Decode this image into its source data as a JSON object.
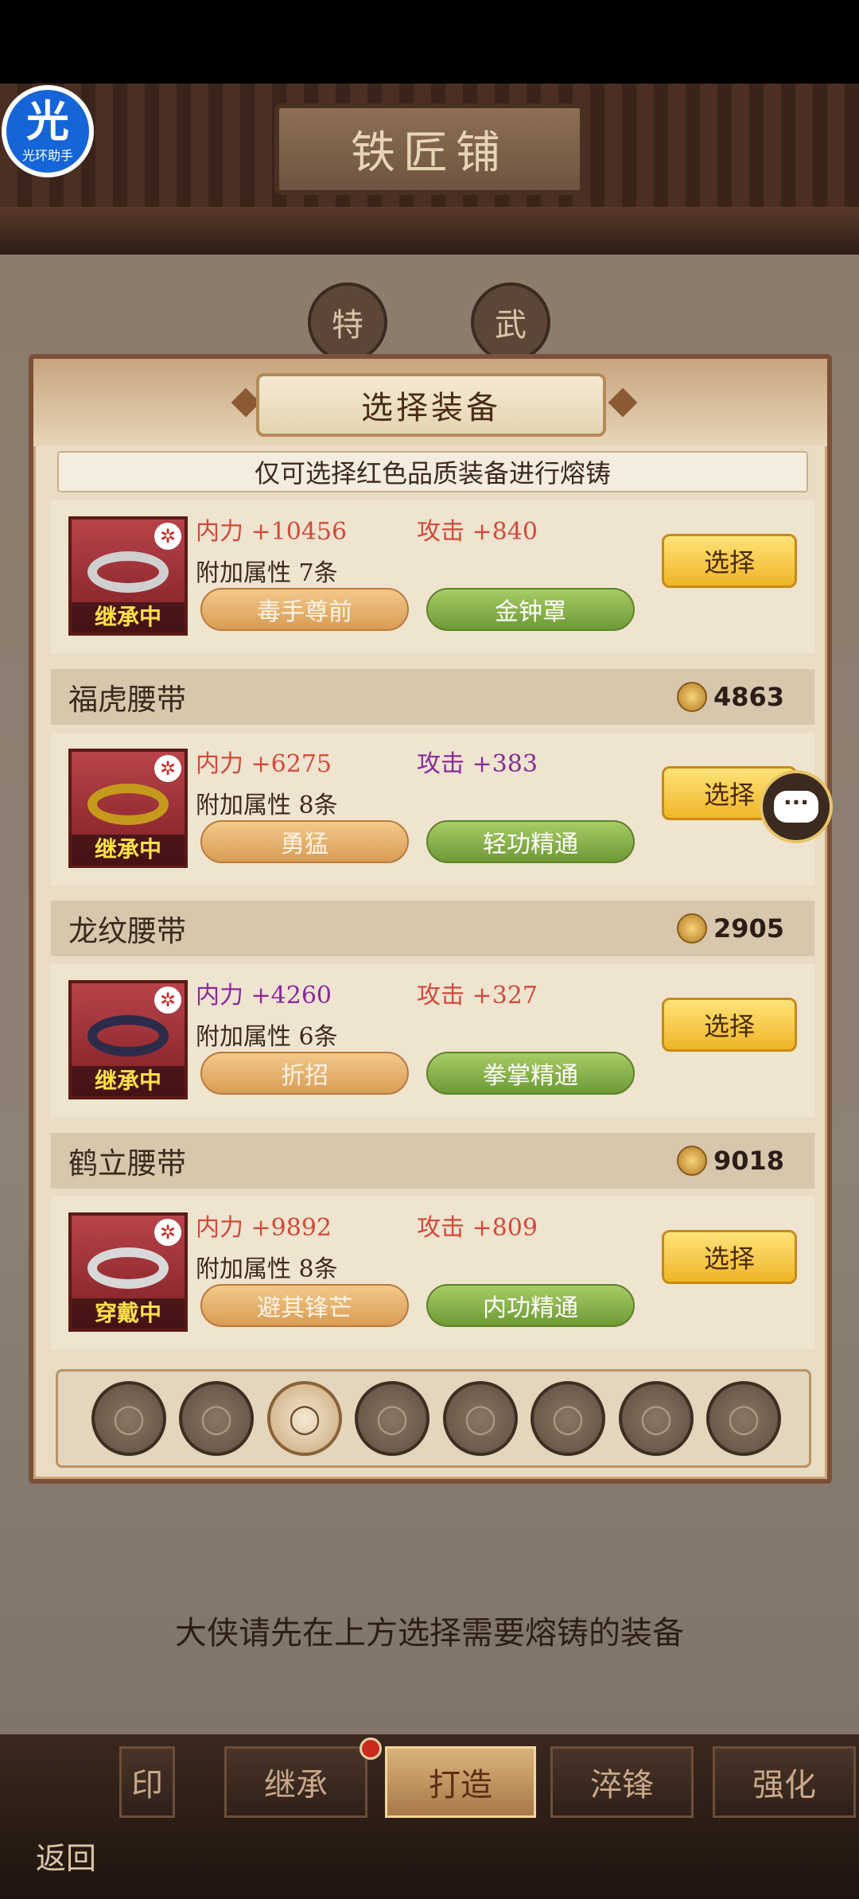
{
  "header": {
    "title": "铁匠铺"
  },
  "assistant": {
    "big": "光",
    "small": "光环助手"
  },
  "bg_tabs": [
    "特",
    "武"
  ],
  "modal": {
    "title": "选择装备",
    "notice": "仅可选择红色品质装备进行熔铸",
    "select_label": "选择",
    "items": [
      {
        "name": "",
        "score": "",
        "state": "继承中",
        "internal": "内力 +10456",
        "internal_color": "#d24a3a",
        "attack": "攻击 +840",
        "attack_color": "#d24a3a",
        "extra": "附加属性  7条",
        "tag1": "毒手尊前",
        "tag2": "金钟罩",
        "belt_color": "#d0d0d0"
      },
      {
        "name": "福虎腰带",
        "score": "4863",
        "state": "继承中",
        "internal": "内力 +6275",
        "internal_color": "#d24a3a",
        "attack": "攻击 +383",
        "attack_color": "#8a2a9a",
        "extra": "附加属性  8条",
        "tag1": "勇猛",
        "tag2": "轻功精通",
        "belt_color": "#c59a1c"
      },
      {
        "name": "龙纹腰带",
        "score": "2905",
        "state": "继承中",
        "internal": "内力 +4260",
        "internal_color": "#8a2a9a",
        "attack": "攻击 +327",
        "attack_color": "#d24a3a",
        "extra": "附加属性  6条",
        "tag1": "折招",
        "tag2": "拳掌精通",
        "belt_color": "#2c2c4a"
      },
      {
        "name": "鹤立腰带",
        "score": "9018",
        "state": "穿戴中",
        "internal": "内力 +9892",
        "internal_color": "#d24a3a",
        "attack": "攻击 +809",
        "attack_color": "#d24a3a",
        "extra": "附加属性  8条",
        "tag1": "避其锋芒",
        "tag2": "内功精通",
        "belt_color": "#d8d8d8"
      }
    ],
    "slots": [
      "weapon-icon",
      "armor-icon",
      "belt-icon",
      "boots-icon",
      "necklace-icon",
      "hat-icon",
      "cloak-icon",
      "ring-icon"
    ]
  },
  "chat": {
    "glyph": "···"
  },
  "hint": "大侠请先在上方选择需要熔铸的装备",
  "bottom_nav": {
    "tabs": [
      "印",
      "继承",
      "打造",
      "淬锋",
      "强化"
    ],
    "active": "打造",
    "back": "返回"
  }
}
